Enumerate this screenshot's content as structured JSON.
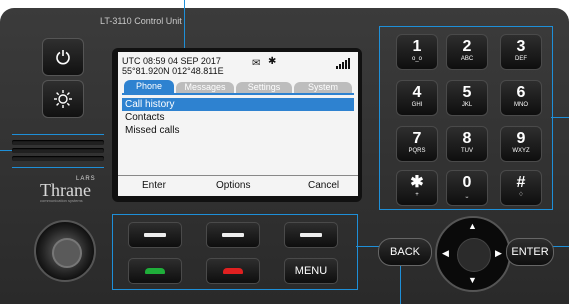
{
  "device": {
    "model_label": "LT-3110 Control Unit",
    "brand_small": "LARS",
    "brand_name": "Thrane",
    "brand_tagline": "communication systems"
  },
  "colors": {
    "accent": "#2e82d0",
    "callout": "#1e8fd8",
    "panel": "#333333"
  },
  "side_buttons": {
    "power": {
      "icon": "power-icon"
    },
    "brightness": {
      "icon": "brightness-icon"
    }
  },
  "screen": {
    "status_line1": "UTC  08:59   04 SEP 2017",
    "status_line2": "55°81.920N  012°48.811E",
    "mail_icon": "✉",
    "bluetooth_icon": "✱",
    "tabs": [
      {
        "label": "Phone",
        "active": true
      },
      {
        "label": "Messages",
        "active": false
      },
      {
        "label": "Settings",
        "active": false
      },
      {
        "label": "System",
        "active": false
      }
    ],
    "menu": [
      "Call history",
      "Contacts",
      "Missed calls"
    ],
    "selected_index": 0,
    "softkeys": [
      "Enter",
      "Options",
      "Cancel"
    ]
  },
  "keypad": [
    {
      "digit": "1",
      "sub": "o_o"
    },
    {
      "digit": "2",
      "sub": "ABC"
    },
    {
      "digit": "3",
      "sub": "DEF"
    },
    {
      "digit": "4",
      "sub": "GHI"
    },
    {
      "digit": "5",
      "sub": "JKL"
    },
    {
      "digit": "6",
      "sub": "MNO"
    },
    {
      "digit": "7",
      "sub": "PQRS"
    },
    {
      "digit": "8",
      "sub": "TUV"
    },
    {
      "digit": "9",
      "sub": "WXYZ"
    },
    {
      "digit": "✱",
      "sub": "+"
    },
    {
      "digit": "0",
      "sub": "⎵"
    },
    {
      "digit": "#",
      "sub": "♢"
    }
  ],
  "buttons": {
    "menu": "MENU",
    "back": "BACK",
    "enter": "ENTER"
  }
}
